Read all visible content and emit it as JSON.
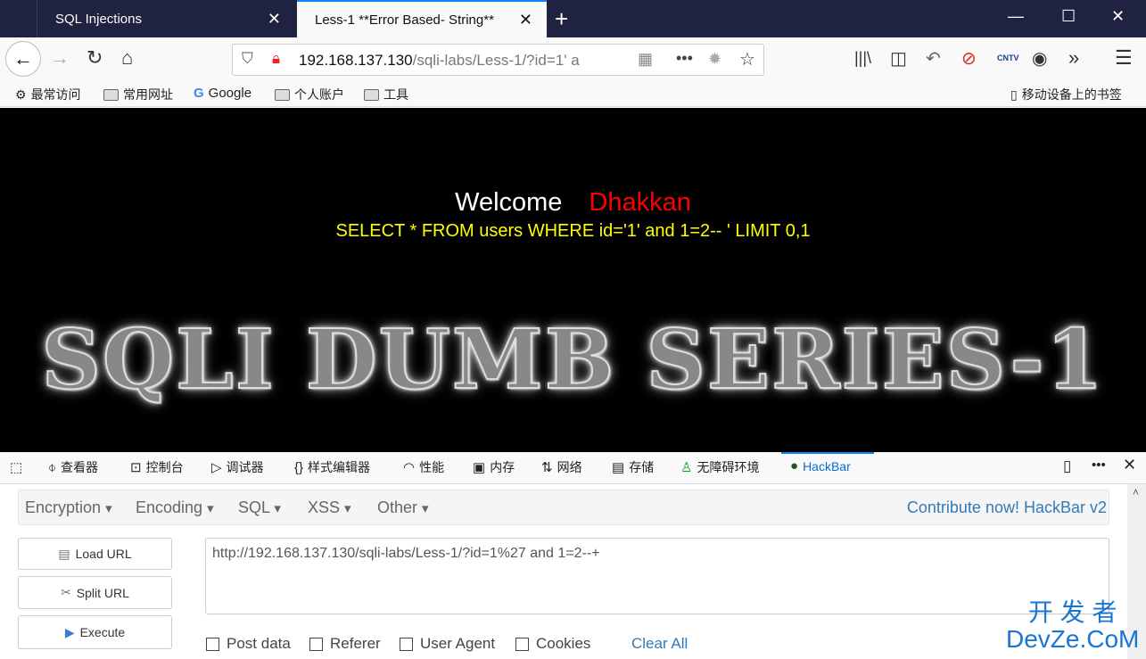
{
  "browser": {
    "tabs": [
      {
        "label": "SQL Injections",
        "active": false
      },
      {
        "label": "Less-1 **Error Based- String**",
        "active": true
      }
    ],
    "url_host": "192.168.137.130",
    "url_path": "/sqli-labs/Less-1/?id=1' a",
    "bookmarks": [
      "最常访问",
      "常用网址",
      "Google",
      "个人账户",
      "工具"
    ],
    "mobile_bookmarks": "移动设备上的书签"
  },
  "page": {
    "welcome": "Welcome",
    "name": "Dhakkan",
    "query": "SELECT * FROM users WHERE id='1' and 1=2-- ' LIMIT 0,1",
    "logo": "SQLI DUMB SERIES-1"
  },
  "devtools": {
    "tabs": [
      "查看器",
      "控制台",
      "调试器",
      "样式编辑器",
      "性能",
      "内存",
      "网络",
      "存储",
      "无障碍环境",
      "HackBar"
    ],
    "active_tab": "HackBar"
  },
  "hackbar": {
    "menu": [
      "Encryption",
      "Encoding",
      "SQL",
      "XSS",
      "Other"
    ],
    "contribute": "Contribute now! HackBar v2",
    "buttons": [
      "Load URL",
      "Split URL",
      "Execute"
    ],
    "url_value": "http://192.168.137.130/sqli-labs/Less-1/?id=1%27 and 1=2--+",
    "checkboxes": [
      {
        "label": "Post data",
        "checked": false
      },
      {
        "label": "Referer",
        "checked": false
      },
      {
        "label": "User Agent",
        "checked": false
      },
      {
        "label": "Cookies",
        "checked": false
      }
    ],
    "clear_all": "Clear All"
  },
  "watermark": {
    "line1": "开 发 者",
    "line2": "DevZe.CoM"
  }
}
